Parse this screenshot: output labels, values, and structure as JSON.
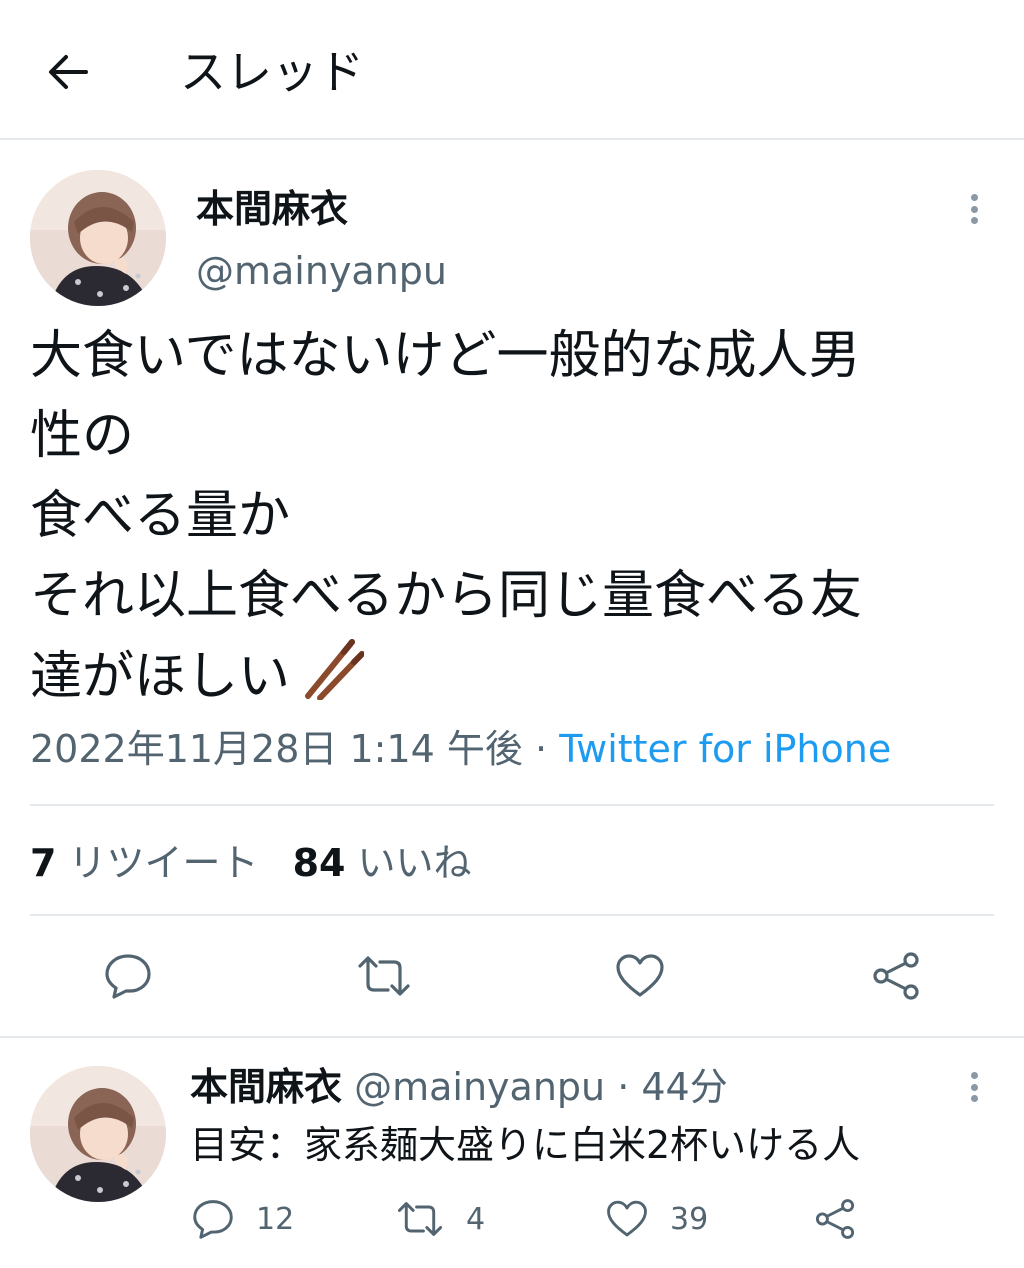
{
  "header": {
    "title": "スレッド"
  },
  "tweet": {
    "name": "本間麻衣",
    "handle": "@mainyanpu",
    "text": "大食いではないけど一般的な成人男\n性の\n食べる量か\nそれ以上食べるから同じ量食べる友\n達がほしい",
    "emoji": "chopsticks-emoji",
    "date": "2022年11月28日 1:14 午後",
    "separator": "·",
    "source": "Twitter for iPhone",
    "retweets_count": "7",
    "retweets_label": "リツイート",
    "likes_count": "84",
    "likes_label": "いいね"
  },
  "reply": {
    "name": "本間麻衣",
    "handle": "@mainyanpu",
    "time": "· 44分",
    "text": "目安：家系麺大盛りに白米2杯いける人",
    "reply_count": "12",
    "retweet_count": "4",
    "like_count": "39"
  },
  "colors": {
    "accent": "#1d9bf0",
    "text": "#0f1419",
    "muted": "#536471",
    "divider": "#e6e9ec"
  },
  "icons": [
    "back-arrow-icon",
    "more-icon",
    "reply-icon",
    "retweet-icon",
    "like-icon",
    "share-icon"
  ]
}
